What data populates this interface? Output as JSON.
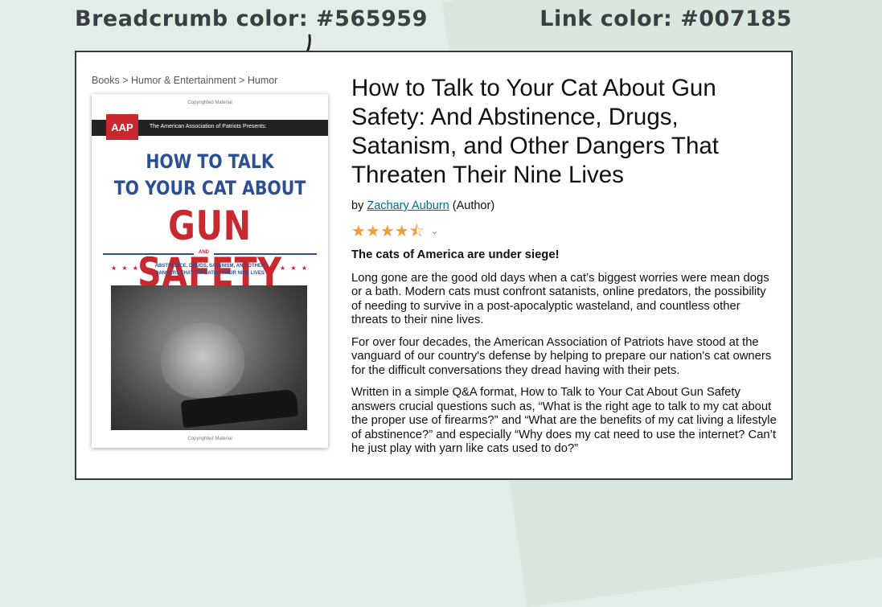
{
  "annotations": {
    "left": "Breadcrumb color: #565959",
    "right": "Link color: #007185"
  },
  "colors": {
    "breadcrumb": "#565959",
    "link": "#007185",
    "stars": "#f29d38",
    "cover_red": "#c8282e",
    "cover_blue": "#2c4f93"
  },
  "breadcrumb": "Books > Humor & Entertainment > Humor",
  "cover": {
    "copyright_top": "Copyrighted Material",
    "logo": "AAP",
    "presents": "The American Association of Patriots Presents:",
    "title_line1": "HOW TO TALK",
    "title_line2": "TO YOUR CAT ABOUT",
    "title_line3": "GUN SAFETY",
    "and": "AND",
    "stars": "★ ★ ★",
    "subtitle": "ABSTINENCE, DRUGS, SATANISM, AND OTHER DANGERS THAT THREATEN THEIR NINE LIVES",
    "copyright_bottom": "Copyrighted Material"
  },
  "product": {
    "title": "How to Talk to Your Cat About Gun Safety: And Abstinence, Drugs, Satanism, and Other Dangers That Threaten Their Nine Lives",
    "by": "by",
    "author": "Zachary Auburn",
    "author_role": "(Author)",
    "rating_value": 4.5,
    "rating_stars": "★★★★⯪",
    "rating_chevron": "⌄"
  },
  "description": {
    "lead": "The cats of America are under siege!",
    "paragraphs": [
      "Long gone are the good old days when a cat’s biggest worries were mean dogs or a bath. Modern cats must confront satanists, online predators, the possibility of needing to survive in a post-apocalyptic wasteland, and countless other threats to their nine lives.",
      "For over four decades, the American Association of Patriots have stood at the vanguard of our country's defense by helping to prepare our nation's cat owners for the difficult conversations they dread having with their pets.",
      "Written in a simple Q&A format, How to Talk to Your Cat About Gun Safety answers crucial questions such as, “What is the right age to talk to my cat about the proper use of firearms?” and “What are the benefits of my cat living a lifestyle of abstinence?” and especially “Why does my cat need to use the internet? Can’t he just play with yarn like cats used to do?”"
    ]
  }
}
